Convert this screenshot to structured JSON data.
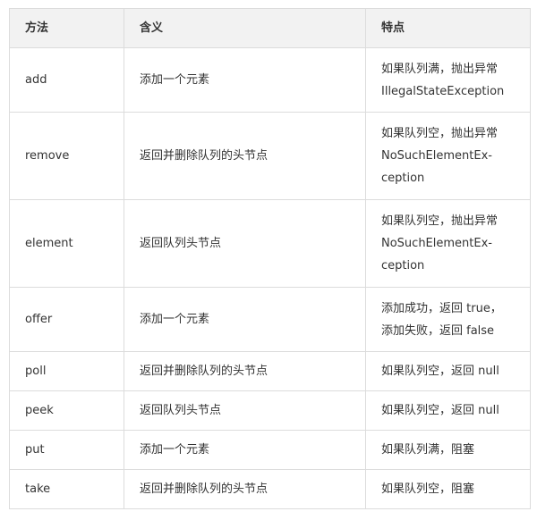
{
  "table": {
    "headers": [
      "方法",
      "含义",
      "特点"
    ],
    "rows": [
      {
        "method": "add",
        "meaning": "添加一个元素",
        "feature": [
          "如果队列满，抛出异常",
          "IllegalStateException"
        ]
      },
      {
        "method": "remove",
        "meaning": "返回并删除队列的头节点",
        "feature": [
          "如果队列空，抛出异常",
          "NoSuchElementEx-",
          "ception"
        ]
      },
      {
        "method": "element",
        "meaning": "返回队列头节点",
        "feature": [
          "如果队列空，抛出异常",
          "NoSuchElementEx-",
          "ception"
        ]
      },
      {
        "method": "offer",
        "meaning": "添加一个元素",
        "feature": [
          "添加成功，返回 true，",
          "添加失败，返回 false"
        ]
      },
      {
        "method": "poll",
        "meaning": "返回并删除队列的头节点",
        "feature": [
          "如果队列空，返回 null"
        ]
      },
      {
        "method": "peek",
        "meaning": "返回队列头节点",
        "feature": [
          "如果队列空，返回 null"
        ]
      },
      {
        "method": "put",
        "meaning": "添加一个元素",
        "feature": [
          "如果队列满，阻塞"
        ]
      },
      {
        "method": "take",
        "meaning": "返回并删除队列的头节点",
        "feature": [
          "如果队列空，阻塞"
        ]
      }
    ]
  },
  "colors": {
    "header_bg": "#f2f2f2",
    "border": "#dcdcdc",
    "text": "#333333"
  }
}
